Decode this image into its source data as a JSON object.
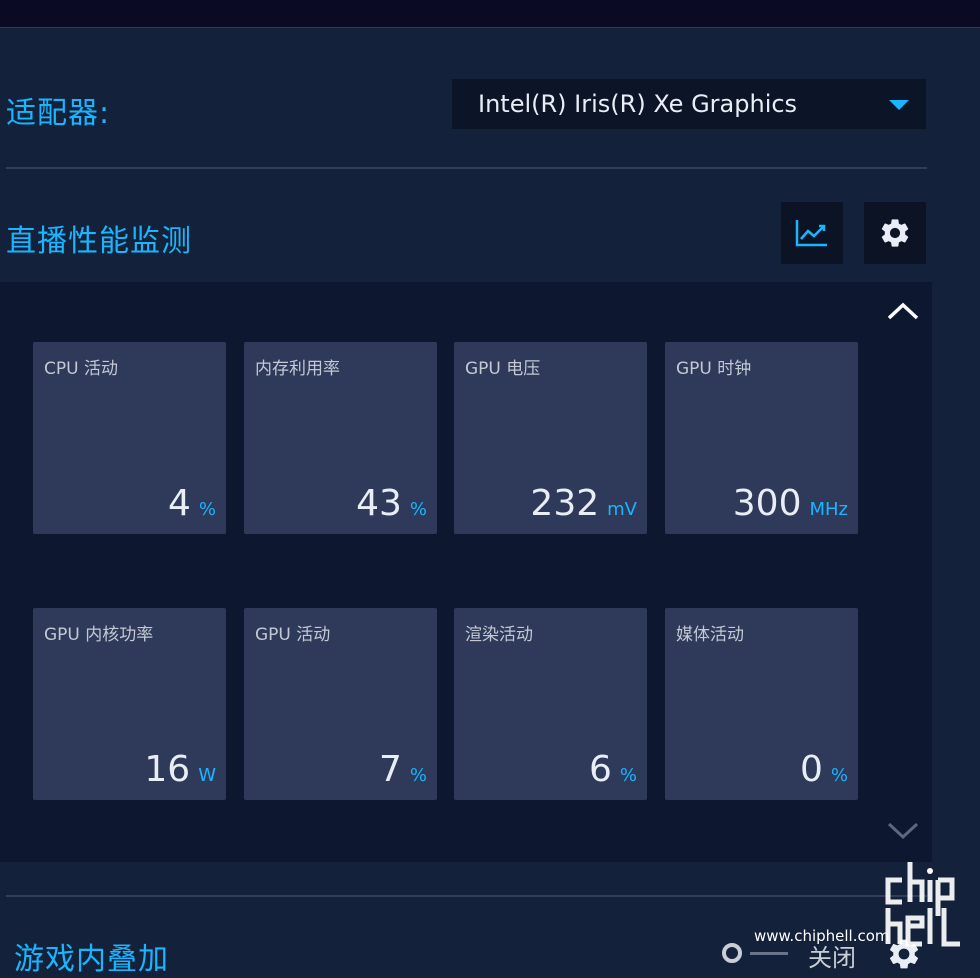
{
  "adapter": {
    "label": "适配器:",
    "selected": "Intel(R) Iris(R) Xe Graphics"
  },
  "monitoring": {
    "title": "直播性能监测",
    "buttons": {
      "chart_icon": "line-chart-icon",
      "settings_icon": "gear-icon",
      "collapse_icon": "chevron-up-icon",
      "scroll_icon": "chevron-down-icon"
    },
    "tiles": [
      {
        "label": "CPU 活动",
        "value": "4",
        "unit": "%"
      },
      {
        "label": "内存利用率",
        "value": "43",
        "unit": "%"
      },
      {
        "label": "GPU 电压",
        "value": "232",
        "unit": "mV"
      },
      {
        "label": "GPU 时钟",
        "value": "300",
        "unit": "MHz"
      },
      {
        "label": "GPU 内核功率",
        "value": "16",
        "unit": "W"
      },
      {
        "label": "GPU 活动",
        "value": "7",
        "unit": "%"
      },
      {
        "label": "渲染活动",
        "value": "6",
        "unit": "%"
      },
      {
        "label": "媒体活动",
        "value": "0",
        "unit": "%"
      }
    ]
  },
  "overlay": {
    "title": "游戏内叠加",
    "toggle_state": "关闭",
    "settings_icon": "gear-icon"
  },
  "watermark": {
    "url": "www.chiphell.com",
    "logo": "chiphell-logo"
  },
  "colors": {
    "accent": "#19b5fe",
    "background": "#14213a",
    "panel": "#0d1730",
    "tile": "#2f3a5a"
  }
}
